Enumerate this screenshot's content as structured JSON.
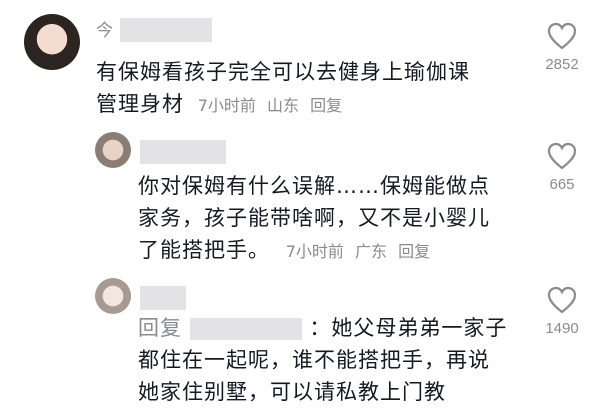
{
  "comments": [
    {
      "username": "今",
      "text": "有保姆看孩子完全可以去健身上瑜伽课管理身材",
      "line1": "有保姆看孩子完全可以去健身上瑜伽课",
      "line2": "管理身材",
      "time": "7小时前",
      "location": "山东",
      "reply_label": "回复",
      "likes": "2852"
    }
  ],
  "replies": [
    {
      "line1": "你对保姆有什么误解……保姆能做点",
      "line2": "家务，孩子能带啥啊，又不是小婴儿",
      "line3": "了能搭把手。",
      "time": "7小时前",
      "location": "广东",
      "reply_label": "回复",
      "likes": "665"
    },
    {
      "prefix": "回复",
      "line1_text": "：她父母弟弟一家子",
      "line2": "都住在一起呢，谁不能搭把手，再说",
      "line3": "她家住别墅，可以请私教上门教",
      "likes": "1490"
    }
  ],
  "icons": {
    "like": "heart-outline-icon"
  },
  "colors": {
    "text": "#161823",
    "muted": "#8a8b91",
    "background": "#ffffff"
  }
}
